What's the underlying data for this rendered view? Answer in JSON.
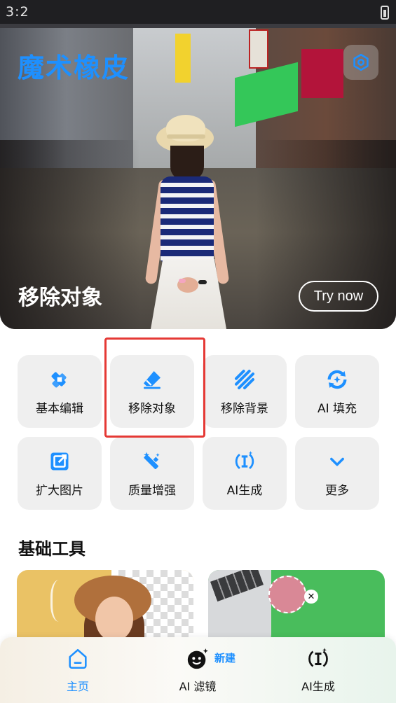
{
  "status": {
    "time": "3:2"
  },
  "hero": {
    "app_title": "魔术橡皮",
    "feature_label": "移除对象",
    "try_button": "Try now"
  },
  "tools": [
    {
      "label": "基本编辑",
      "icon": "edit-pencil-icon"
    },
    {
      "label": "移除对象",
      "icon": "eraser-icon"
    },
    {
      "label": "移除背景",
      "icon": "stripes-icon"
    },
    {
      "label": "AI 填充",
      "icon": "ai-fill-icon"
    },
    {
      "label": "扩大图片",
      "icon": "expand-icon"
    },
    {
      "label": "质量增强",
      "icon": "magic-wand-icon"
    },
    {
      "label": "AI生成",
      "icon": "ai-text-cursor-icon"
    },
    {
      "label": "更多",
      "icon": "chevron-down-icon"
    }
  ],
  "basic_tools": {
    "title": "基础工具"
  },
  "bottom_nav": {
    "items": [
      {
        "label": "主页",
        "icon": "home-icon"
      },
      {
        "label": "AI 滤镜",
        "icon": "ai-filter-icon"
      },
      {
        "label": "AI生成",
        "icon": "ai-text-cursor-icon"
      }
    ],
    "new_badge": "新建"
  },
  "colors": {
    "accent": "#1e90ff",
    "tile_bg": "#efefef",
    "highlight": "#e53935"
  }
}
